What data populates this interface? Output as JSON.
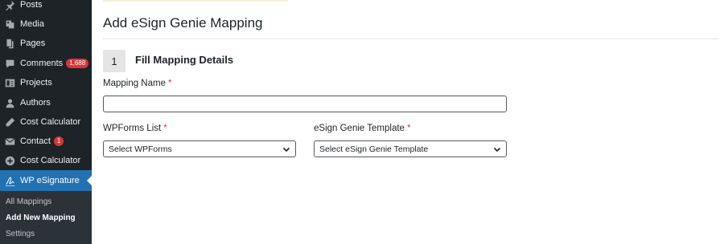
{
  "sidebar": {
    "items": [
      {
        "label": "Posts",
        "icon": "pin-icon"
      },
      {
        "label": "Media",
        "icon": "media-icon"
      },
      {
        "label": "Pages",
        "icon": "pages-icon"
      },
      {
        "label": "Comments",
        "icon": "comment-icon",
        "badge": "1,688"
      },
      {
        "label": "Projects",
        "icon": "portfolio-icon"
      },
      {
        "label": "Authors",
        "icon": "user-icon"
      },
      {
        "label": "Cost Calculator",
        "icon": "pencil-icon"
      },
      {
        "label": "Contact",
        "icon": "mail-icon",
        "badge": "1"
      },
      {
        "label": "Cost Calculator",
        "icon": "plus-circle-icon"
      },
      {
        "label": "WP eSignature",
        "icon": "signature-icon",
        "active": true
      }
    ],
    "submenu": [
      {
        "label": "All Mappings"
      },
      {
        "label": "Add New Mapping",
        "current": true
      },
      {
        "label": "Settings"
      }
    ],
    "colors": {
      "background": "#1d2327",
      "active": "#2271b1",
      "badge": "#d63638"
    }
  },
  "main": {
    "title": "Add eSign Genie Mapping",
    "step": {
      "number": "1",
      "title": "Fill Mapping Details"
    },
    "mapping_name": {
      "label": "Mapping Name",
      "required": "*",
      "value": ""
    },
    "wpforms_list": {
      "label": "WPForms List",
      "required": "*",
      "selected": "Select WPForms"
    },
    "esign_template": {
      "label": "eSign Genie Template",
      "required": "*",
      "selected": "Select eSign Genie Template"
    }
  }
}
